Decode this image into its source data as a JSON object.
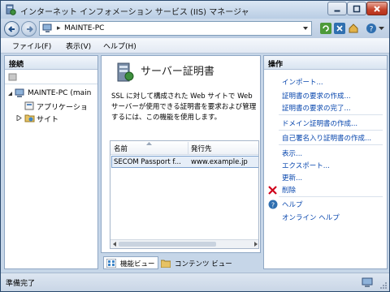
{
  "window": {
    "title": "インターネット インフォメーション サービス (IIS) マネージャ",
    "minimize_icon": "minimize-icon",
    "maximize_icon": "maximize-icon",
    "close_icon": "close-icon"
  },
  "address": {
    "path": "MAINTE-PC",
    "separator": "▸"
  },
  "menu": {
    "file": "ファイル(F)",
    "view": "表示(V)",
    "help": "ヘルプ(H)"
  },
  "connections": {
    "header": "接続",
    "tree": [
      {
        "label": "MAINTE-PC (main",
        "icon": "computer-icon",
        "expanded": true
      },
      {
        "label": "アプリケーショ",
        "icon": "app-pool-icon"
      },
      {
        "label": "サイト",
        "icon": "sites-folder-icon",
        "expanded": false
      }
    ]
  },
  "feature": {
    "title": "サーバー証明書",
    "description": "SSL に対して構成された Web サイトで Web サーバーが使用できる証明書を要求および管理するには、この機能を使用します。",
    "columns": [
      "名前",
      "発行先"
    ],
    "rows": [
      {
        "name": "SECOM Passport f...",
        "issued_to": "www.example.jp"
      }
    ]
  },
  "view_tabs": {
    "features": "機能ビュー",
    "content": "コンテンツ ビュー"
  },
  "actions": {
    "header": "操作",
    "import": "インポート...",
    "create_request": "証明書の要求の作成...",
    "complete_request": "証明書の要求の完了...",
    "domain_cert": "ドメイン証明書の作成...",
    "self_signed": "自己署名入り証明書の作成...",
    "view": "表示...",
    "export": "エクスポート...",
    "renew": "更新...",
    "delete": "削除",
    "help": "ヘルプ",
    "online_help": "オンライン ヘルプ"
  },
  "status": {
    "text": "準備完了"
  },
  "colors": {
    "link": "#0645ad",
    "delete_red": "#d0021b",
    "frame": "#2b4a6e"
  }
}
